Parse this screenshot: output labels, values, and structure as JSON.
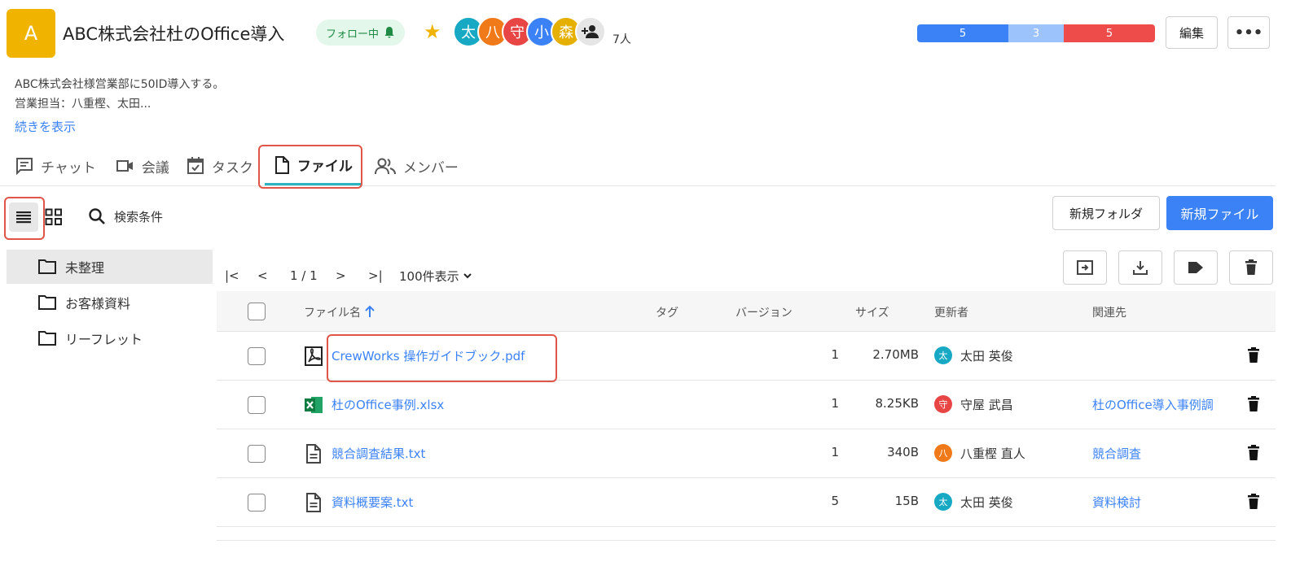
{
  "header": {
    "avatar_letter": "A",
    "title": "ABC株式会社杜のOffice導入",
    "follow_label": "フォロー中",
    "member_count": "7人",
    "members": [
      {
        "char": "太",
        "color": "#17a9c4"
      },
      {
        "char": "八",
        "color": "#f07a1a"
      },
      {
        "char": "守",
        "color": "#e84545"
      },
      {
        "char": "小",
        "color": "#3b82f6"
      },
      {
        "char": "森",
        "color": "#e6b000"
      }
    ],
    "progress": [
      {
        "value": "5",
        "color": "#3b82f6"
      },
      {
        "value": "3",
        "color": "#9cc3fb"
      },
      {
        "value": "5",
        "color": "#ee4b4b"
      }
    ],
    "edit_label": "編集",
    "more_label": "•••"
  },
  "description": {
    "line1": "ABC株式会社様営業部に50ID導入する。",
    "line2": "営業担当：八重樫、太田...",
    "show_more": "続きを表示"
  },
  "tabs": [
    {
      "label": "チャット"
    },
    {
      "label": "会議"
    },
    {
      "label": "タスク"
    },
    {
      "label": "ファイル"
    },
    {
      "label": "メンバー"
    }
  ],
  "toolbar": {
    "search_label": "検索条件",
    "new_folder": "新規フォルダ",
    "new_file": "新規ファイル"
  },
  "folders": [
    {
      "label": "未整理"
    },
    {
      "label": "お客様資料"
    },
    {
      "label": "リーフレット"
    }
  ],
  "pager": {
    "first": "|<",
    "prev": "<",
    "page": "1 / 1",
    "next": ">",
    "last": ">|",
    "per_page": "100件表示"
  },
  "table": {
    "columns": {
      "name": "ファイル名",
      "tag": "タグ",
      "version": "バージョン",
      "size": "サイズ",
      "updater": "更新者",
      "related": "関連先"
    },
    "rows": [
      {
        "name": "CrewWorks 操作ガイドブック.pdf",
        "icon": "pdf-icon",
        "version": "1",
        "size": "2.70MB",
        "updater": "太田 英俊",
        "updater_char": "太",
        "updater_color": "#17a9c4",
        "related": ""
      },
      {
        "name": "杜のOffice事例.xlsx",
        "icon": "excel-icon",
        "version": "1",
        "size": "8.25KB",
        "updater": "守屋 武昌",
        "updater_char": "守",
        "updater_color": "#e84545",
        "related": "杜のOffice導入事例調"
      },
      {
        "name": "競合調査結果.txt",
        "icon": "text-file-icon",
        "version": "1",
        "size": "340B",
        "updater": "八重樫 直人",
        "updater_char": "八",
        "updater_color": "#f07a1a",
        "related": "競合調査"
      },
      {
        "name": "資料概要案.txt",
        "icon": "text-file-icon",
        "version": "5",
        "size": "15B",
        "updater": "太田 英俊",
        "updater_char": "太",
        "updater_color": "#17a9c4",
        "related": "資料検討"
      }
    ]
  }
}
